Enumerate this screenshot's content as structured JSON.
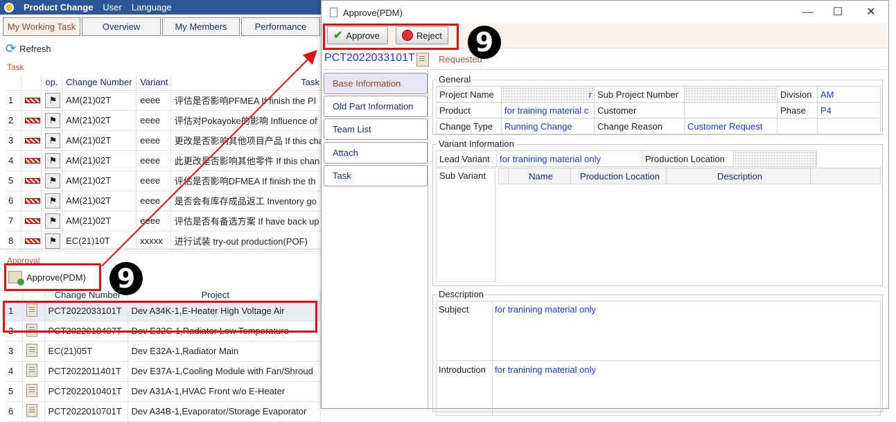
{
  "app": {
    "title": "Product Change",
    "menu": [
      "User",
      "Language"
    ]
  },
  "nav_tabs": [
    "My Working Task",
    "Overview",
    "My Members",
    "Performance"
  ],
  "refresh_label": "Refresh",
  "task": {
    "section_label": "Task",
    "headers": [
      "op.",
      "Change Number",
      "Variant",
      "Task"
    ],
    "rows": [
      {
        "n": "1",
        "change": "AM(21)02T",
        "variant": "eeee",
        "task": "评估是否影响PFMEA  If finish the PI"
      },
      {
        "n": "2",
        "change": "AM(21)02T",
        "variant": "eeee",
        "task": "评估对Pokayoke的影响 Influence of"
      },
      {
        "n": "3",
        "change": "AM(21)02T",
        "variant": "eeee",
        "task": "更改是否影响其他项目产品 If this cha"
      },
      {
        "n": "4",
        "change": "AM(21)02T",
        "variant": "eeee",
        "task": "此更改是否影响其他零件 If this chan"
      },
      {
        "n": "5",
        "change": "AM(21)02T",
        "variant": "eeee",
        "task": "评估是否影响DFMEA  If finish the th"
      },
      {
        "n": "6",
        "change": "AM(21)02T",
        "variant": "eeee",
        "task": "是否会有库存成品返工 Inventory go"
      },
      {
        "n": "7",
        "change": "AM(21)02T",
        "variant": "eeee",
        "task": "评估是否有备选方案 If have back up"
      },
      {
        "n": "8",
        "change": "EC(21)10T",
        "variant": "xxxxx",
        "task": "进行试装 try-out production(POF)"
      }
    ]
  },
  "approval": {
    "section_label": "Approval",
    "button_label": "Approve(PDM)",
    "headers": [
      "Change Number",
      "Project"
    ],
    "rows": [
      {
        "n": "1",
        "change": "PCT2022033101T",
        "project": "Dev A34K-1,E-Heater High Voltage Air"
      },
      {
        "n": "2",
        "change": "PCT2022010407T",
        "project": "Dev E32C-1,Radiator Low Temperature"
      },
      {
        "n": "3",
        "change": "EC(21)05T",
        "project": "Dev E32A-1,Radiator Main"
      },
      {
        "n": "4",
        "change": "PCT2022011401T",
        "project": "Dev E37A-1,Cooling Module with Fan/Shroud"
      },
      {
        "n": "5",
        "change": "PCT2022010401T",
        "project": "Dev A31A-1,HVAC Front w/o E-Heater"
      },
      {
        "n": "6",
        "change": "PCT2022010701T",
        "project": "Dev A34B-1,Evaporator/Storage Evaporator"
      }
    ]
  },
  "dialog": {
    "title": "Approve(PDM)",
    "approve_label": "Approve",
    "reject_label": "Reject",
    "change_number": "PCT2022033101T",
    "status": "Requested",
    "menu": [
      "Base Information",
      "Old Part Information",
      "Team List",
      "Attach",
      "Task"
    ],
    "general": {
      "legend": "General",
      "project_name_label": "Project Name",
      "project_name_tail": "r",
      "sub_project_label": "Sub Project Number",
      "division_label": "Division",
      "division": "AM",
      "product_label": "Product",
      "product": "for training material c",
      "customer_label": "Customer",
      "phase_label": "Phase",
      "phase": "P4",
      "change_type_label": "Change Type",
      "change_type": "Running Change",
      "change_reason_label": "Change Reason",
      "change_reason": "Customer Request"
    },
    "variant": {
      "legend": "Variant Information",
      "lead_variant_label": "Lead Variant",
      "lead_variant": "for tranining material only",
      "production_location_label": "Production Location",
      "sub_variant_label": "Sub Variant",
      "columns": [
        "Name",
        "Production Location",
        "Description"
      ]
    },
    "description": {
      "legend": "Description",
      "subject_label": "Subject",
      "subject": "for tranining material only",
      "introduction_label": "Introduction",
      "introduction": "for tranining material only"
    }
  },
  "annotations": {
    "step_number": "9",
    "highlight_color": "#e01010"
  }
}
